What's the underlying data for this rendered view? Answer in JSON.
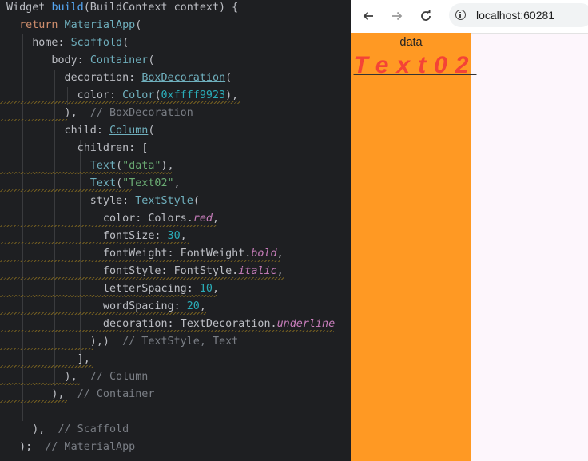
{
  "editor": {
    "lines": [
      [
        {
          "t": "Widget ",
          "c": "par"
        },
        {
          "t": "build",
          "c": "fn"
        },
        {
          "t": "(BuildContext context) {",
          "c": "par"
        }
      ],
      [
        {
          "t": "  return ",
          "c": "kw"
        },
        {
          "t": "MaterialApp",
          "c": "cls"
        },
        {
          "t": "(",
          "c": "par"
        }
      ],
      [
        {
          "t": "    home: ",
          "c": "par"
        },
        {
          "t": "Scaffold",
          "c": "cls"
        },
        {
          "t": "(",
          "c": "par"
        }
      ],
      [
        {
          "t": "       body: ",
          "c": "par"
        },
        {
          "t": "Container",
          "c": "cls"
        },
        {
          "t": "(",
          "c": "par"
        }
      ],
      [
        {
          "t": "         decoration: ",
          "c": "par"
        },
        {
          "t": "BoxDecoration",
          "c": "cls ul"
        },
        {
          "t": "(",
          "c": "par"
        }
      ],
      [
        {
          "t": "           color: ",
          "c": "par"
        },
        {
          "t": "Color",
          "c": "cls"
        },
        {
          "t": "(",
          "c": "par"
        },
        {
          "t": "0xffff9923",
          "c": "num"
        },
        {
          "t": "),",
          "c": "par"
        }
      ],
      [
        {
          "t": "         ),  ",
          "c": "par"
        },
        {
          "t": "// BoxDecoration",
          "c": "cm"
        }
      ],
      [
        {
          "t": "         child: ",
          "c": "par"
        },
        {
          "t": "Column",
          "c": "cls ul"
        },
        {
          "t": "(",
          "c": "par"
        }
      ],
      [
        {
          "t": "           children: [",
          "c": "par"
        }
      ],
      [
        {
          "t": "             ",
          "c": "par"
        },
        {
          "t": "Text",
          "c": "cls"
        },
        {
          "t": "(",
          "c": "par"
        },
        {
          "t": "\"data\"",
          "c": "str"
        },
        {
          "t": "),",
          "c": "par"
        }
      ],
      [
        {
          "t": "             ",
          "c": "par"
        },
        {
          "t": "Text",
          "c": "cls"
        },
        {
          "t": "(",
          "c": "par"
        },
        {
          "t": "\"Text02\"",
          "c": "str"
        },
        {
          "t": ",",
          "c": "par"
        }
      ],
      [
        {
          "t": "             style: ",
          "c": "par"
        },
        {
          "t": "TextStyle",
          "c": "cls"
        },
        {
          "t": "(",
          "c": "par"
        }
      ],
      [
        {
          "t": "               color: Colors.",
          "c": "par"
        },
        {
          "t": "red",
          "c": "it"
        },
        {
          "t": ",",
          "c": "par"
        }
      ],
      [
        {
          "t": "               fontSize: ",
          "c": "par"
        },
        {
          "t": "30",
          "c": "num"
        },
        {
          "t": ",",
          "c": "par"
        }
      ],
      [
        {
          "t": "               fontWeight: FontWeight.",
          "c": "par"
        },
        {
          "t": "bold",
          "c": "it"
        },
        {
          "t": ",",
          "c": "par"
        }
      ],
      [
        {
          "t": "               fontStyle: FontStyle.",
          "c": "par"
        },
        {
          "t": "italic",
          "c": "it"
        },
        {
          "t": ",",
          "c": "par"
        }
      ],
      [
        {
          "t": "               letterSpacing: ",
          "c": "par"
        },
        {
          "t": "10",
          "c": "num"
        },
        {
          "t": ",",
          "c": "par"
        }
      ],
      [
        {
          "t": "               wordSpacing: ",
          "c": "par"
        },
        {
          "t": "20",
          "c": "num"
        },
        {
          "t": ",",
          "c": "par"
        }
      ],
      [
        {
          "t": "               decoration: TextDecoration.",
          "c": "par"
        },
        {
          "t": "underline",
          "c": "it"
        }
      ],
      [
        {
          "t": "             ),)  ",
          "c": "par"
        },
        {
          "t": "// TextStyle, Text",
          "c": "cm"
        }
      ],
      [
        {
          "t": "           ],",
          "c": "par"
        }
      ],
      [
        {
          "t": "         ),  ",
          "c": "par"
        },
        {
          "t": "// Column",
          "c": "cm"
        }
      ],
      [
        {
          "t": "       ),  ",
          "c": "par"
        },
        {
          "t": "// Container",
          "c": "cm"
        }
      ],
      [
        {
          "t": "",
          "c": "par"
        }
      ],
      [
        {
          "t": "    ),  ",
          "c": "par"
        },
        {
          "t": "// Scaffold",
          "c": "cm"
        }
      ],
      [
        {
          "t": "  );  ",
          "c": "par"
        },
        {
          "t": "// MaterialApp",
          "c": "cm"
        }
      ]
    ]
  },
  "browser": {
    "url": "localhost:60281",
    "icons": {
      "back": "back-arrow-icon",
      "forward": "forward-arrow-icon",
      "reload": "reload-icon",
      "info": "info-icon"
    }
  },
  "app": {
    "container_color": "#ff9923",
    "page_background": "#fdf6fc",
    "texts": {
      "first": "data",
      "second": "Text02"
    },
    "second_color": "#f44336"
  }
}
